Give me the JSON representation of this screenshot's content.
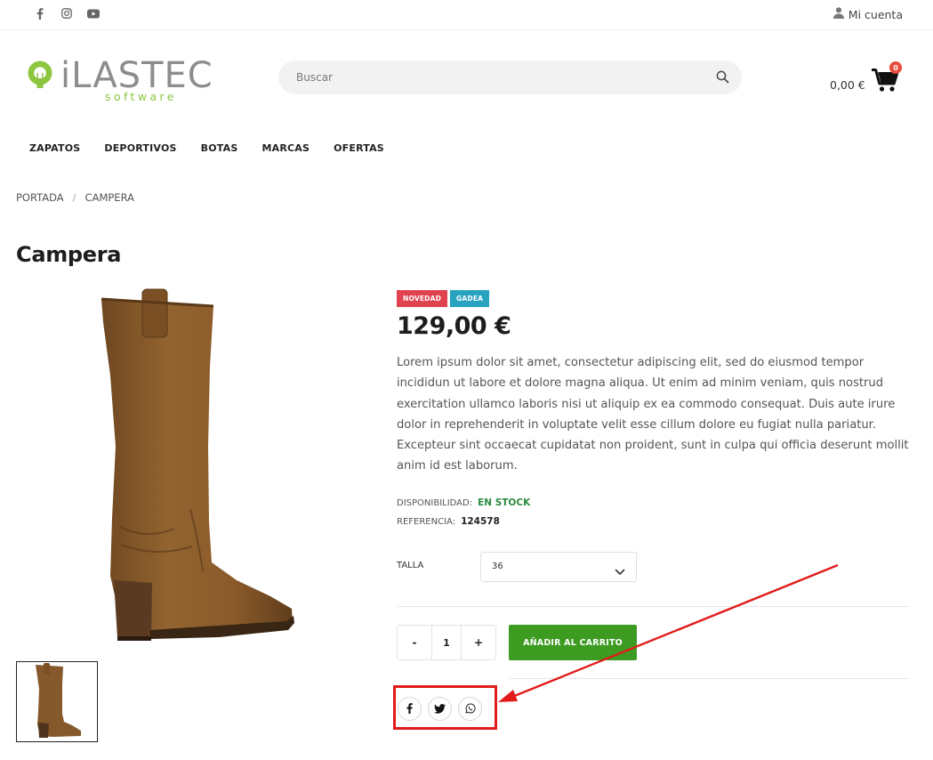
{
  "topbar": {
    "social": [
      {
        "icon": "facebook-icon"
      },
      {
        "icon": "instagram-icon"
      },
      {
        "icon": "youtube-icon"
      }
    ],
    "account_label": "Mi cuenta"
  },
  "header": {
    "logo_text": "iLASTEC",
    "logo_subtext": "software",
    "search_placeholder": "Buscar",
    "cart_total": "0,00 €",
    "cart_count": "0"
  },
  "menu": {
    "items": [
      "ZAPATOS",
      "DEPORTIVOS",
      "BOTAS",
      "MARCAS",
      "OFERTAS"
    ]
  },
  "breadcrumb": {
    "items": [
      "PORTADA",
      "CAMPERA"
    ],
    "separator": "/"
  },
  "product": {
    "title": "Campera",
    "badges": {
      "new": "NOVEDAD",
      "brand": "GADEA"
    },
    "price": "129,00 €",
    "description": "Lorem ipsum dolor sit amet, consectetur adipiscing elit, sed do eiusmod tempor incididun ut labore et dolore magna aliqua. Ut enim ad minim veniam, quis nostrud exercitation ullamco laboris nisi ut aliquip ex ea commodo consequat. Duis aute irure dolor in reprehenderit in voluptate velit esse cillum dolore eu fugiat nulla pariatur. Excepteur sint occaecat cupidatat non proident, sunt in culpa qui officia deserunt mollit anim id est laborum.",
    "availability_label": "DISPONIBILIDAD:",
    "availability_value": "EN STOCK",
    "reference_label": "REFERENCIA:",
    "reference_value": "124578",
    "size_label": "TALLA",
    "size_value": "36",
    "qty_minus": "-",
    "qty_value": "1",
    "qty_plus": "+",
    "add_to_cart": "AÑADIR AL CARRITO"
  },
  "share": {
    "buttons": [
      "facebook-icon",
      "twitter-icon",
      "whatsapp-icon"
    ]
  },
  "colors": {
    "accent_green": "#3d9b22",
    "badge_new": "#e0424f",
    "badge_brand": "#27a3c0",
    "stock_green": "#2a8a3f",
    "annotation_red": "#e21b1b",
    "cart_badge": "#e84c3d"
  }
}
